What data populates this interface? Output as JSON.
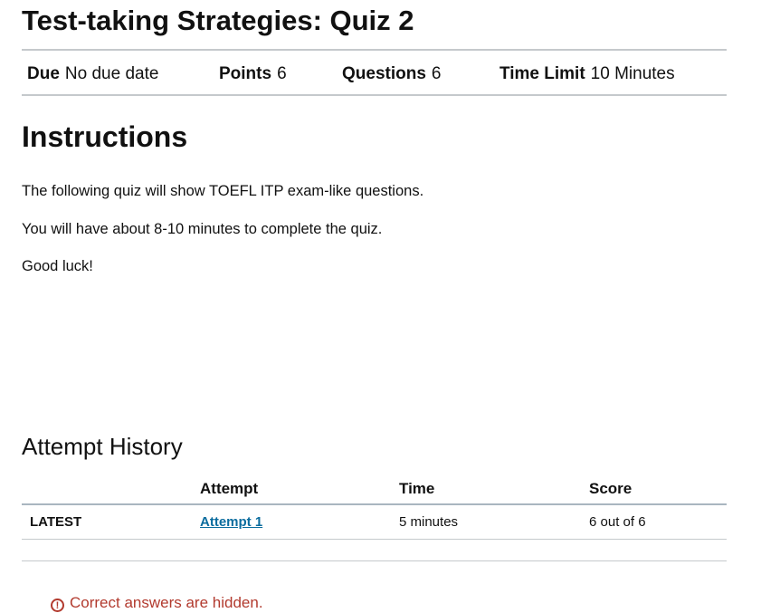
{
  "quiz": {
    "title": "Test-taking Strategies: Quiz 2"
  },
  "details": [
    {
      "label": "Due",
      "value": "No due date"
    },
    {
      "label": "Points",
      "value": "6"
    },
    {
      "label": "Questions",
      "value": "6"
    },
    {
      "label": "Time Limit",
      "value": "10 Minutes"
    }
  ],
  "instructions": {
    "heading": "Instructions",
    "paragraphs": [
      "The following quiz will show TOEFL ITP exam-like questions.",
      "You will have about 8-10 minutes to complete the quiz.",
      "Good luck!"
    ]
  },
  "attempt_history": {
    "heading": "Attempt History",
    "columns": [
      "",
      "Attempt",
      "Time",
      "Score"
    ],
    "rows": [
      {
        "label": "LATEST",
        "attempt": "Attempt 1",
        "time": "5 minutes",
        "score": "6 out of 6"
      }
    ]
  },
  "notice": {
    "icon": "warning-icon",
    "text": "Correct answers are hidden."
  },
  "colors": {
    "link": "#0b6c9e",
    "notice": "#b23a2e",
    "divider": "#c5c9cc"
  }
}
